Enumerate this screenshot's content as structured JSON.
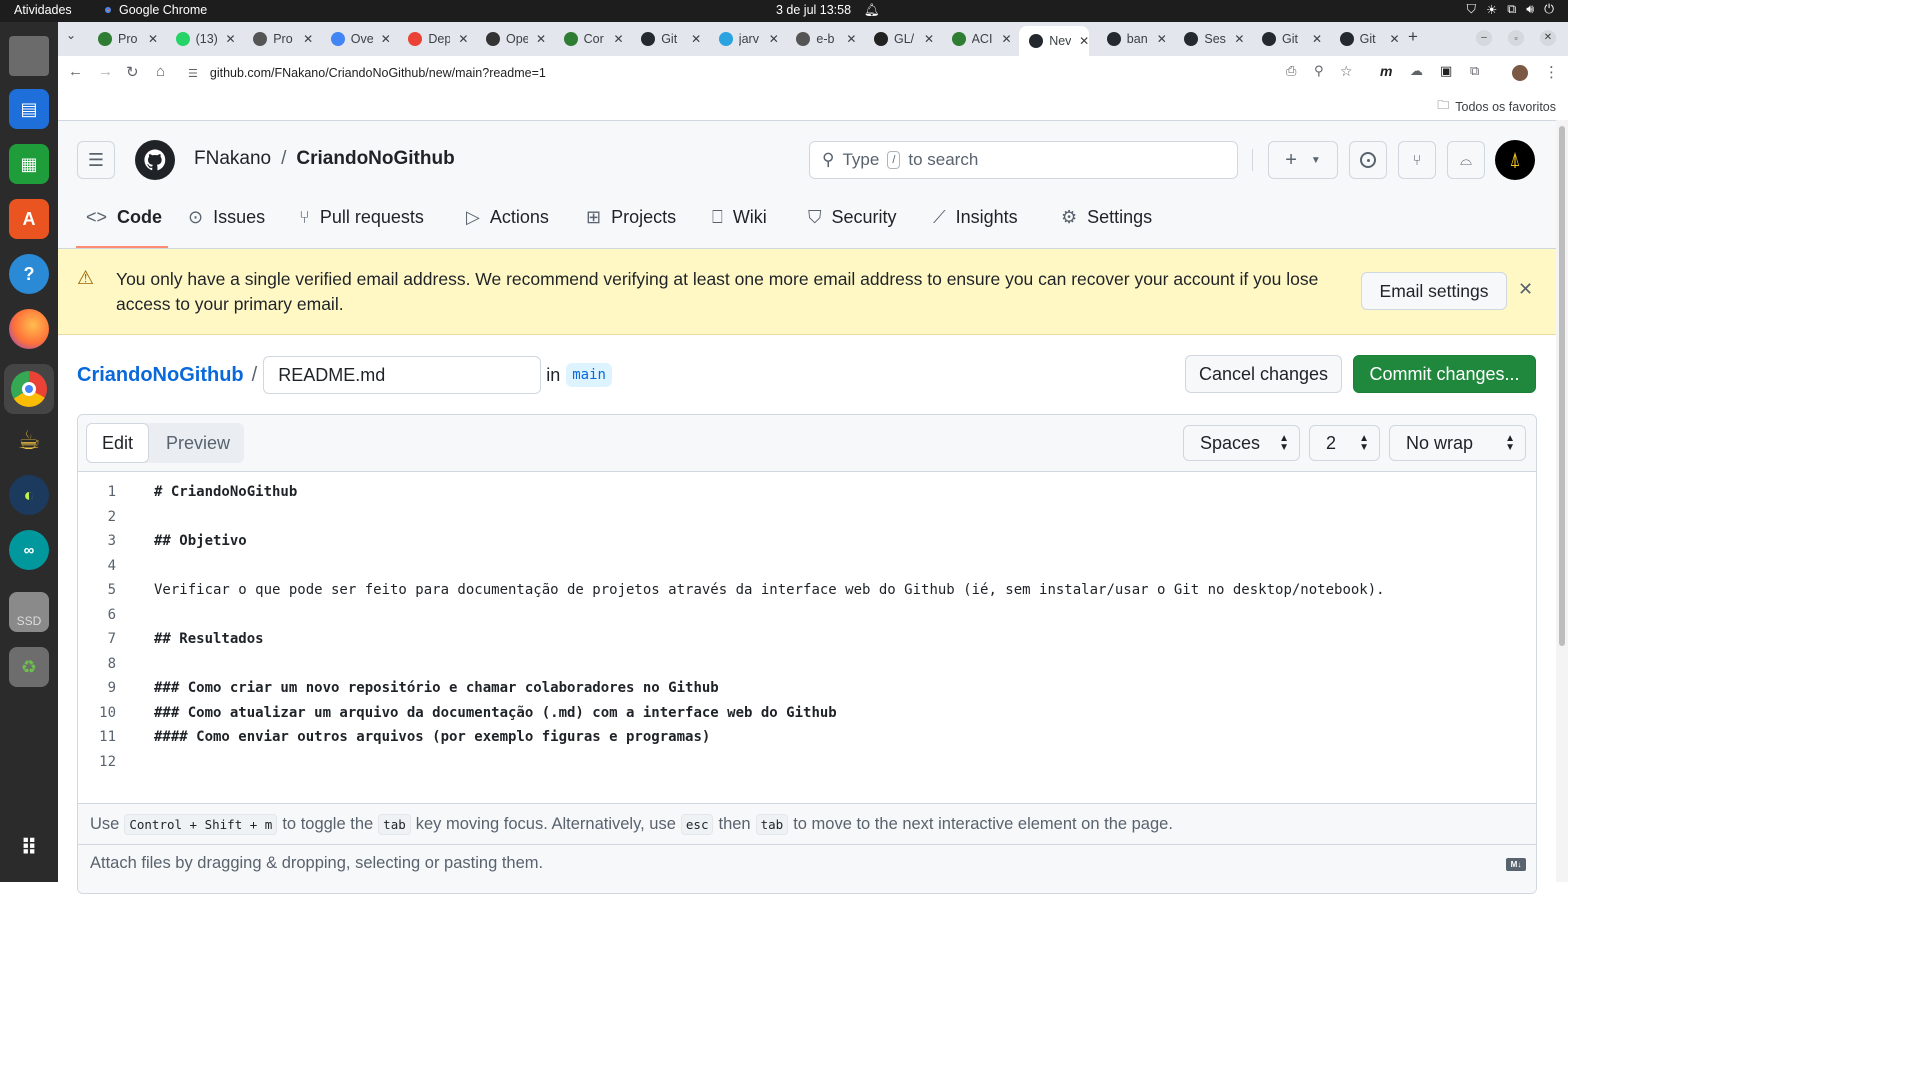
{
  "system": {
    "activities": "Atividades",
    "app_name": "Google Chrome",
    "clock": "3 de jul  13:58"
  },
  "tabs": [
    {
      "label": "Pro",
      "icon": "leaf-icon",
      "color": "#2e7d32"
    },
    {
      "label": "(13)",
      "icon": "whatsapp-icon",
      "color": "#25d366"
    },
    {
      "label": "Pro",
      "icon": "globe-icon",
      "color": "#555555"
    },
    {
      "label": "Ove",
      "icon": "docs-icon",
      "color": "#4285f4"
    },
    {
      "label": "Dep",
      "icon": "gmail-icon",
      "color": "#ea4335"
    },
    {
      "label": "Ope",
      "icon": "openai-icon",
      "color": "#333333"
    },
    {
      "label": "Cor",
      "icon": "leaf-icon",
      "color": "#2e7d32"
    },
    {
      "label": "Git",
      "icon": "github-icon",
      "color": "#24292f"
    },
    {
      "label": "jarv",
      "icon": "telegram-icon",
      "color": "#2aa3e0"
    },
    {
      "label": "e-b",
      "icon": "globe-icon",
      "color": "#555555"
    },
    {
      "label": "GL/",
      "icon": "m-icon",
      "color": "#222222"
    },
    {
      "label": "ACI",
      "icon": "leaf-icon",
      "color": "#2e7d32"
    },
    {
      "label": "Nev",
      "icon": "github-icon",
      "color": "#24292f",
      "active": true
    },
    {
      "label": "ban",
      "icon": "github-icon",
      "color": "#24292f"
    },
    {
      "label": "Ses",
      "icon": "github-icon",
      "color": "#24292f"
    },
    {
      "label": "Git",
      "icon": "github-icon",
      "color": "#24292f"
    },
    {
      "label": "Git",
      "icon": "github-icon",
      "color": "#24292f"
    }
  ],
  "browser": {
    "url": "github.com/FNakano/CriandoNoGithub/new/main?readme=1",
    "bookmarks_label": "Todos os favoritos"
  },
  "header": {
    "owner": "FNakano",
    "separator": "/",
    "repo": "CriandoNoGithub",
    "search_prefix": "Type",
    "search_key": "/",
    "search_suffix": "to search"
  },
  "repo_nav": [
    {
      "label": "Code",
      "icon": "code-icon",
      "active": true
    },
    {
      "label": "Issues",
      "icon": "issue-icon"
    },
    {
      "label": "Pull requests",
      "icon": "pull-request-icon"
    },
    {
      "label": "Actions",
      "icon": "play-icon"
    },
    {
      "label": "Projects",
      "icon": "table-icon"
    },
    {
      "label": "Wiki",
      "icon": "book-icon"
    },
    {
      "label": "Security",
      "icon": "shield-icon"
    },
    {
      "label": "Insights",
      "icon": "graph-icon"
    },
    {
      "label": "Settings",
      "icon": "gear-icon"
    }
  ],
  "banner": {
    "message": "You only have a single verified email address. We recommend verifying at least one more email address to ensure you can recover your account if you lose access to your primary email.",
    "button": "Email settings"
  },
  "file": {
    "breadcrumb_repo": "CriandoNoGithub",
    "separator": "/",
    "filename": "README.md",
    "in_label": "in",
    "branch": "main",
    "cancel_label": "Cancel changes",
    "commit_label": "Commit changes..."
  },
  "editor": {
    "tab_edit": "Edit",
    "tab_preview": "Preview",
    "indent_mode": "Spaces",
    "indent_size": "2",
    "wrap_mode": "No wrap",
    "lines": [
      {
        "n": "1",
        "text": "# CriandoNoGithub",
        "bold": true
      },
      {
        "n": "2",
        "text": ""
      },
      {
        "n": "3",
        "text": "## Objetivo",
        "bold": true
      },
      {
        "n": "4",
        "text": ""
      },
      {
        "n": "5",
        "text": "Verificar o que pode ser feito para documentação de projetos através da interface web do Github (ié, sem instalar/usar o Git no desktop/notebook)."
      },
      {
        "n": "6",
        "text": ""
      },
      {
        "n": "7",
        "text": "## Resultados",
        "bold": true
      },
      {
        "n": "8",
        "text": ""
      },
      {
        "n": "9",
        "text": "### Como criar um novo repositório e chamar colaboradores no Github",
        "bold": true
      },
      {
        "n": "10",
        "text": "### Como atualizar um arquivo da documentação (.md) com a interface web do Github",
        "bold": true
      },
      {
        "n": "11",
        "text": "#### Como enviar outros arquivos (por exemplo figuras e programas)",
        "bold": true
      },
      {
        "n": "12",
        "text": ""
      }
    ],
    "hint": {
      "use": "Use",
      "shortcut": "Control + Shift + m",
      "toggle": "to toggle the",
      "tab_key": "tab",
      "moving": "key moving focus. Alternatively, use",
      "esc_key": "esc",
      "then": "then",
      "tab_key2": "tab",
      "rest": "to move to the next interactive element on the page."
    },
    "attach": "Attach files by dragging & dropping, selecting or pasting them.",
    "md_badge": "M↓"
  },
  "colors": {
    "commit_green": "#1f883d",
    "link_blue": "#0969da",
    "banner_bg": "#fff8c5",
    "tab_strip": "#e3e7ed"
  }
}
